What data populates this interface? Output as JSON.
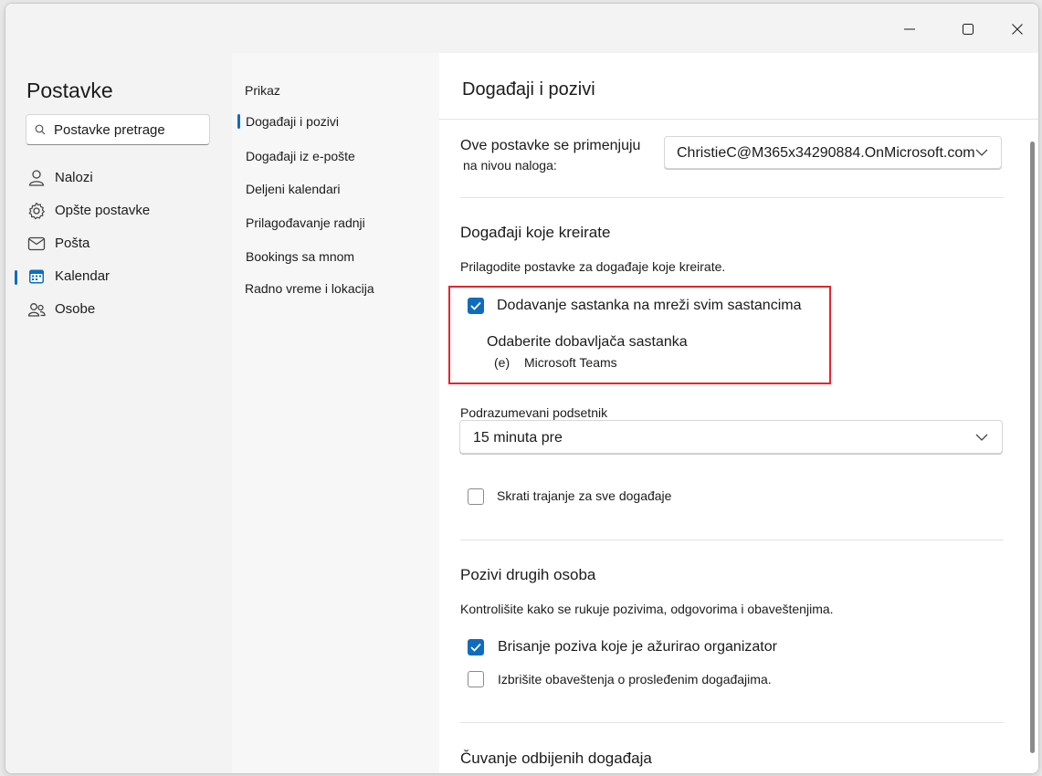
{
  "window_controls": {
    "minimize": "minimize-icon",
    "maximize": "maximize-icon",
    "close": "close-icon"
  },
  "sidebar": {
    "title": "Postavke",
    "search_placeholder": "Postavke pretrage",
    "items": [
      {
        "label": "Nalozi",
        "icon": "person-icon"
      },
      {
        "label": "Opšte postavke",
        "icon": "gear-icon"
      },
      {
        "label": "Pošta",
        "icon": "mail-icon"
      },
      {
        "label": "Kalendar",
        "icon": "calendar-icon",
        "active": true
      },
      {
        "label": "Osobe",
        "icon": "people-icon"
      }
    ]
  },
  "subnav": {
    "items": [
      {
        "label": "Prikaz"
      },
      {
        "label": "Događaji i pozivi",
        "active": true
      },
      {
        "label": "Događaji iz e-pošte"
      },
      {
        "label": "Deljeni kalendari"
      },
      {
        "label": "Prilagođavanje radnji"
      },
      {
        "label": "Bookings sa mnom"
      },
      {
        "label": "Radno vreme i lokacija"
      }
    ]
  },
  "main": {
    "title": "Događaji i pozivi",
    "account_scope_line1": "Ove postavke se primenjuju",
    "account_scope_line2": "na nivou naloga:",
    "account_value": "ChristieC@M365x34290884.OnMicrosoft.com",
    "section_created": {
      "heading": "Događaji koje kreirate",
      "description": "Prilagodite postavke za događaje koje kreirate.",
      "online_meeting_label": "Dodavanje sastanka na mreži svim sastancima",
      "online_meeting_checked": true,
      "provider_label": "Odaberite dobavljača sastanka",
      "provider_glyph": "(e)",
      "provider_value": "Microsoft Teams",
      "reminder_label": "Podrazumevani podsetnik",
      "reminder_value": "15 minuta pre",
      "shorten_label": "Skrati trajanje za sve događaje",
      "shorten_checked": false
    },
    "section_invites": {
      "heading": "Pozivi drugih osoba",
      "description": "Kontrolišite kako se rukuje pozivima, odgovorima i obaveštenjima.",
      "delete_updated_label": "Brisanje poziva koje je ažurirao organizator",
      "delete_updated_checked": true,
      "delete_forwarded_label": "Izbrišite obaveštenja o prosleđenim događajima.",
      "delete_forwarded_checked": false
    },
    "section_declined": {
      "heading": "Čuvanje odbijenih događaja"
    }
  },
  "colors": {
    "accent": "#0f6cbd",
    "highlight": "#e3262a"
  }
}
